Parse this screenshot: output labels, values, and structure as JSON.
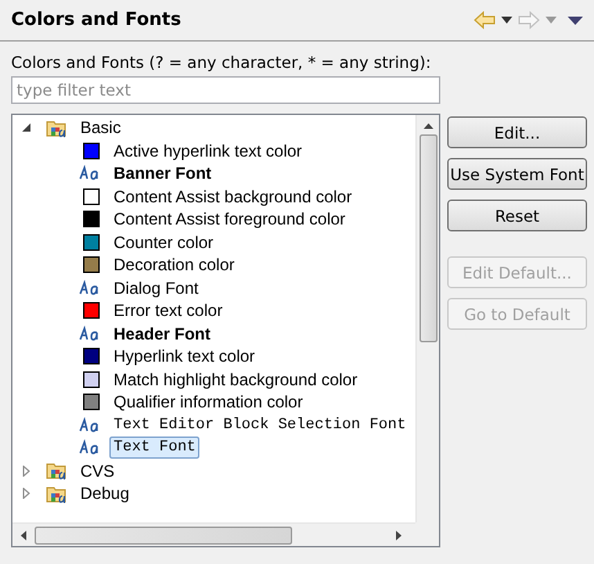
{
  "header": {
    "title": "Colors and Fonts"
  },
  "filter": {
    "label": "Colors and Fonts (? = any character, * = any string):",
    "placeholder": "type filter text"
  },
  "tree": [
    {
      "label": "Basic",
      "expanded": true,
      "children": [
        {
          "kind": "color",
          "label": "Active hyperlink text color",
          "color": "#0000ff",
          "selected": false
        },
        {
          "kind": "bold-font",
          "label": "Banner Font",
          "selected": false
        },
        {
          "kind": "color",
          "label": "Content Assist background color",
          "color": "#ffffff",
          "selected": false
        },
        {
          "kind": "color",
          "label": "Content Assist foreground color",
          "color": "#000000",
          "selected": false
        },
        {
          "kind": "color",
          "label": "Counter color",
          "color": "#0080a0",
          "selected": false
        },
        {
          "kind": "color",
          "label": "Decoration color",
          "color": "#957c4a",
          "selected": false
        },
        {
          "kind": "font",
          "label": "Dialog Font",
          "selected": false
        },
        {
          "kind": "color",
          "label": "Error text color",
          "color": "#ff0000",
          "selected": false
        },
        {
          "kind": "bold-font",
          "label": "Header Font",
          "selected": false
        },
        {
          "kind": "color",
          "label": "Hyperlink text color",
          "color": "#000080",
          "selected": false
        },
        {
          "kind": "color",
          "label": "Match highlight background color",
          "color": "#d0d0f0",
          "selected": false
        },
        {
          "kind": "color",
          "label": "Qualifier information color",
          "color": "#808080",
          "selected": false
        },
        {
          "kind": "mono-font",
          "label": "Text Editor Block Selection Font",
          "selected": false
        },
        {
          "kind": "mono-font",
          "label": "Text Font",
          "selected": true
        }
      ]
    },
    {
      "label": "CVS",
      "expanded": false
    },
    {
      "label": "Debug",
      "expanded": false
    }
  ],
  "buttons": [
    {
      "label": "Edit...",
      "disabled": false
    },
    {
      "label": "Use System Font",
      "disabled": false
    },
    {
      "label": "Reset",
      "disabled": false
    },
    {
      "label": "Edit Default...",
      "disabled": true
    },
    {
      "label": "Go to Default",
      "disabled": true
    }
  ]
}
